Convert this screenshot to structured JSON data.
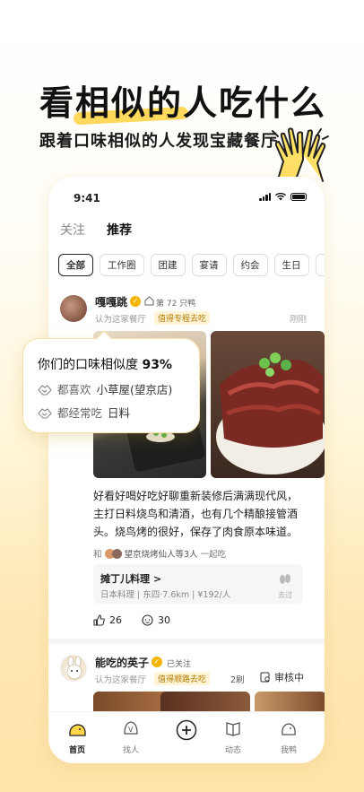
{
  "hero": {
    "headline": "看相似的人吃什么",
    "subline": "跟着口味相似的人发现宝藏餐厅"
  },
  "status": {
    "time": "9:41"
  },
  "tabs": [
    {
      "label": "关注"
    },
    {
      "label": "推荐"
    }
  ],
  "chips": [
    "全部",
    "工作圈",
    "团建",
    "宴请",
    "约会",
    "生日",
    ""
  ],
  "post1": {
    "username": "嘎嘎跳",
    "rank": "第 72 只鸭",
    "meta": "认为这家餐厅",
    "tag": "值得专程去吃",
    "time": "刚刚",
    "body": "好看好喝好吃好聊重新装修后满满现代风，主打日料烧鸟和清酒，也有几个精酿接管酒头。烧鸟烤的很好，保存了肉食原本味道。",
    "with_prefix": "和",
    "with_text": "望京烧烤仙人等3人",
    "with_suffix": "一起吃",
    "place_name": "摊丁儿料理 >",
    "place_info": "日本料理 | 东四·7.6km | ¥192/人",
    "place_go": "去过",
    "likes": "26",
    "comments": "30"
  },
  "post2": {
    "username": "能吃的英子",
    "follow": "已关注",
    "meta": "认为这家餐厅",
    "tag": "值得顺路去吃",
    "visits": "2刷",
    "review": "审核中"
  },
  "tabbar": [
    {
      "label": "首页"
    },
    {
      "label": "找人"
    },
    {
      "label": ""
    },
    {
      "label": "动态"
    },
    {
      "label": "我鸭"
    }
  ],
  "bubble": {
    "title": "你们的口味相似度",
    "percent": "93%",
    "row1_label": "都喜欢",
    "row1_value": "小草屋(望京店)",
    "row2_label": "都经常吃",
    "row2_value": "日料"
  },
  "colors": {
    "accent": "#ffd54a",
    "tag_text": "#b27a00",
    "tag_bg": "#fff4d6"
  }
}
